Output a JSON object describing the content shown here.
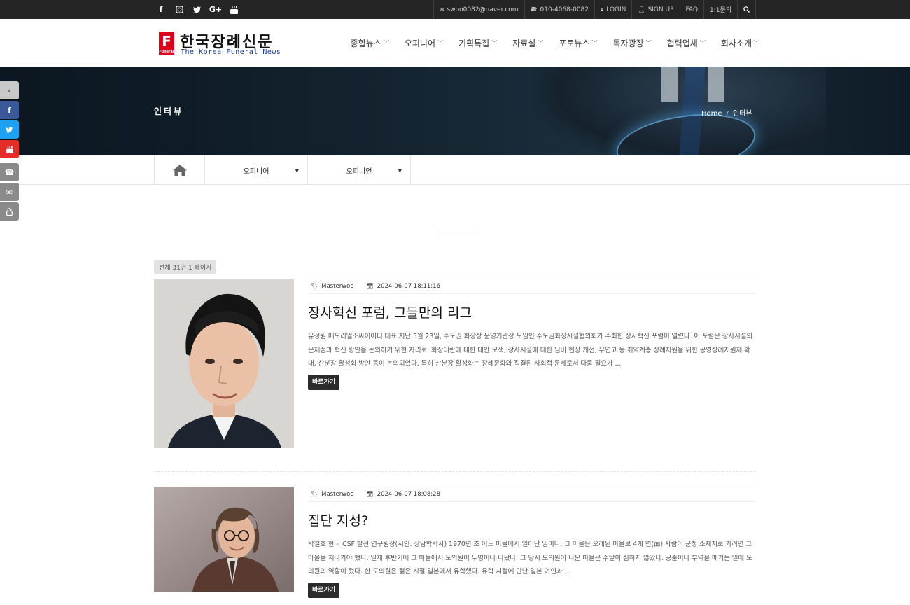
{
  "topbar": {
    "email": "swoo0082@naver.com",
    "phone": "010-4068-0082",
    "login": "LOGIN",
    "signup": "SIGN UP",
    "faq": "FAQ",
    "inquiry": "1:1문의"
  },
  "logo": {
    "mark": "F",
    "mark_small": "Funeral",
    "korean": "한국장례신문",
    "english": "The Korea Funeral News"
  },
  "nav": {
    "items": [
      "종합뉴스",
      "오피니어",
      "기획특집",
      "자료실",
      "포토뉴스",
      "독자광장",
      "협력업체",
      "회사소개"
    ]
  },
  "banner": {
    "title": "인터뷰",
    "crumb_home": "Home",
    "crumb_current": "인터뷰"
  },
  "subnav": {
    "dropdown1": "오피니어",
    "dropdown2": "오피니언"
  },
  "list": {
    "count": "전체 31건 1 페이지",
    "posts": [
      {
        "author": "Masterwoo",
        "date": "2024-06-07 18:11:16",
        "title": "장사혁신 포럼, 그들만의 리그",
        "excerpt": "유성원 메모리얼소싸이어티 대표   지난 5월 23일, 수도권 화장장 운영기관장 모임인 수도권화장시설협의회가 주최한 장사혁신 포럼이 열렸다. 이 포럼은 장사시설의 문제점과 혁신 방안을 논의하기 위한 자리로, 화장대란에 대한 대안 모색, 장사시설에 대한 님비 현상 개선, 무연고 등 취약계층 장례지원을 위한 공영장례지원제 확대, 산분장 활성화 방안 등이 논의되었다. 특히 산분장 활성화는 장례문화와 직결된 사회적 문제로서 다룰 필요가 ...",
        "button": "바로가기"
      },
      {
        "author": "Masterwoo",
        "date": "2024-06-07 18:08:28",
        "title": "집단 지성?",
        "excerpt": "박철호 한국 CSF 발전 연구원장(시인. 상담학박사)   1970년 초 어느 마을에서 일어난 일이다. 그 마을은 오래된 마을로 4개 면(面) 사람이 군청 소재지로 가려면 그 마을을 지나가야 했다. 일제 후반기에 그 마을에서 도의원이 두명이나 나왔다. 그 당시 도의원이 나온 마을은 수탈이 심하지 않았다. 공출이나 부역을 메기는 일에 도의원의 역할이 컸다. 한 도의원은 젊은 시절 일본에서 유학했다. 유학 시절에 만난 일본 여인과 ...",
        "button": "바로가기"
      }
    ]
  },
  "colors": {
    "topbar_bg": "#252525",
    "logo_red": "#d9001b",
    "logo_blue": "#1a3a8f",
    "facebook": "#3b5998",
    "twitter": "#1da1f2",
    "youtube": "#e52d27",
    "gray_tab": "#888888"
  }
}
